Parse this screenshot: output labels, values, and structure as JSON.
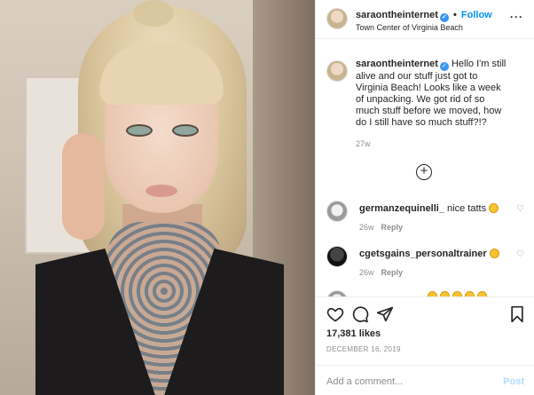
{
  "post": {
    "username": "saraontheinternet",
    "follow_label": "Follow",
    "location": "Town Center of Virginia Beach",
    "caption_text": "Hello I'm still alive and our stuff just got to Virginia Beach! Looks like a week of unpacking. We got rid of so much stuff before we moved, how do I still have so much stuff?!?",
    "caption_time": "27w"
  },
  "comments": [
    {
      "username": "germanzequinelli_",
      "text": "nice tatts",
      "time": "26w",
      "reply": "Reply"
    },
    {
      "username": "cgetsgains_personaltrainer",
      "text": "",
      "time": "26w",
      "reply": "Reply"
    }
  ],
  "actions": {
    "likes": "17,381 likes",
    "date": "DECEMBER 16, 2019"
  },
  "comment_box": {
    "placeholder": "Add a comment...",
    "post_label": "Post"
  },
  "icons": [
    "more-icon",
    "verified-icon",
    "load-more-icon",
    "heart-icon",
    "comment-icon",
    "share-icon",
    "save-icon"
  ]
}
